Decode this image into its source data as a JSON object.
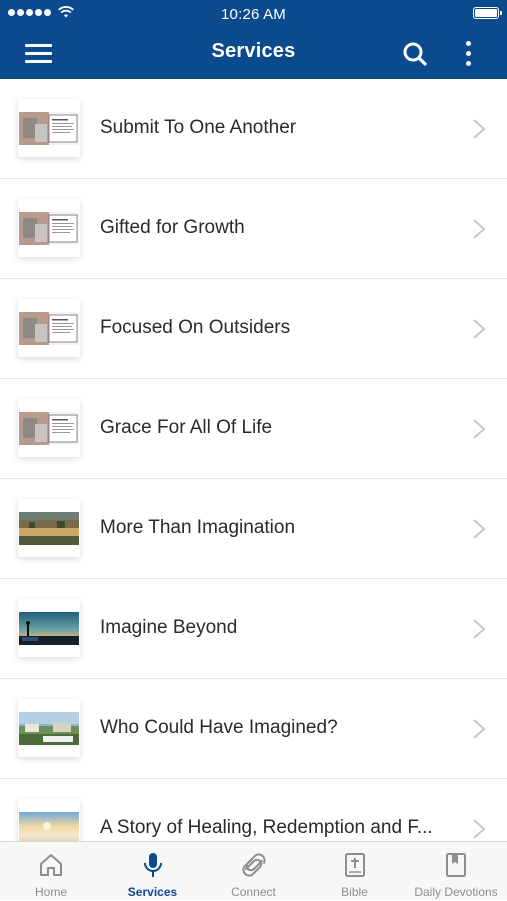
{
  "status_bar": {
    "time": "10:26 AM"
  },
  "nav": {
    "title": "Services",
    "menu_icon": "hamburger-menu-icon",
    "search_icon": "search-icon",
    "more_icon": "more-vertical-icon"
  },
  "colors": {
    "brand": "#0b4a8d",
    "tab_inactive": "#8e8e8e",
    "text": "#2a2a2a"
  },
  "services": [
    {
      "title": "Submit To One Another",
      "thumbnail": "sermon-slide-thumbnail"
    },
    {
      "title": "Gifted for Growth",
      "thumbnail": "sermon-slide-thumbnail"
    },
    {
      "title": "Focused On Outsiders",
      "thumbnail": "sermon-slide-thumbnail"
    },
    {
      "title": "Grace For All Of Life",
      "thumbnail": "sermon-slide-thumbnail"
    },
    {
      "title": "More Than Imagination",
      "thumbnail": "landscape-thumbnail"
    },
    {
      "title": "Imagine Beyond",
      "thumbnail": "sunset-thumbnail"
    },
    {
      "title": "Who Could Have Imagined?",
      "thumbnail": "landscape-thumbnail"
    },
    {
      "title": "A Story of Healing, Redemption and F...",
      "thumbnail": "beach-sunrise-thumbnail"
    }
  ],
  "tabs": [
    {
      "label": "Home",
      "icon": "home-icon",
      "active": false
    },
    {
      "label": "Services",
      "icon": "microphone-icon",
      "active": true
    },
    {
      "label": "Connect",
      "icon": "connect-icon",
      "active": false
    },
    {
      "label": "Bible",
      "icon": "bible-icon",
      "active": false
    },
    {
      "label": "Daily Devotions",
      "icon": "bookmark-book-icon",
      "active": false
    }
  ]
}
